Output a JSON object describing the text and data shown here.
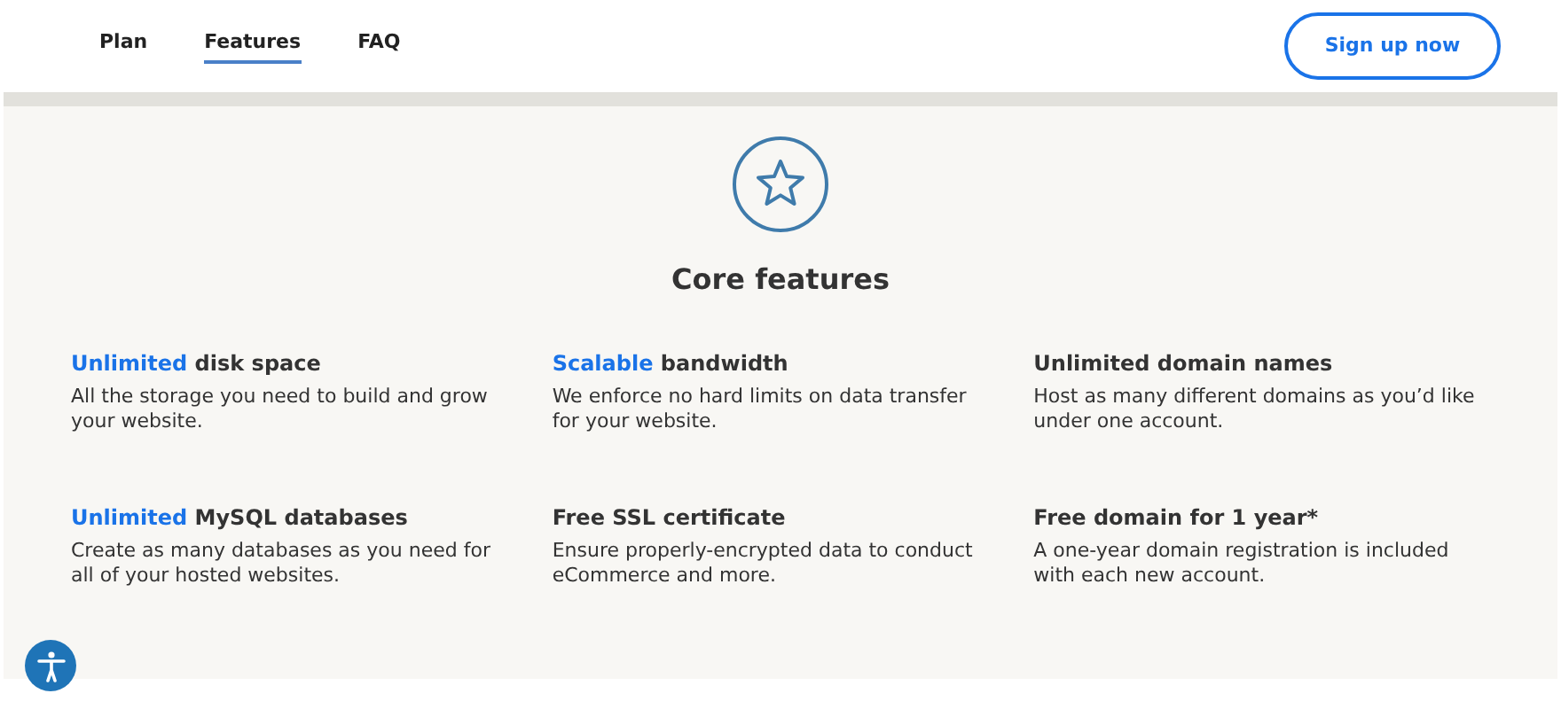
{
  "nav": {
    "links": [
      {
        "label": "Plan",
        "selected": false
      },
      {
        "label": "Features",
        "selected": true
      },
      {
        "label": "FAQ",
        "selected": false
      }
    ],
    "cta": "Sign up now"
  },
  "section": {
    "title": "Core features",
    "features": [
      {
        "highlight": "Unlimited",
        "title": "disk space",
        "description": "All the storage you need to build and grow your website."
      },
      {
        "highlight": "Scalable",
        "title": "bandwidth",
        "description": "We enforce no hard limits on data transfer for your website."
      },
      {
        "title": "Unlimited domain names",
        "description": "Host as many different domains as you’d like under one account."
      },
      {
        "highlight": "Unlimited",
        "title": "MySQL databases",
        "description": "Create as many databases as you need for all of your hosted websites."
      },
      {
        "title": "Free SSL certificate",
        "description": "Ensure properly-encrypted data to conduct eCommerce and more."
      },
      {
        "title": "Free domain for 1 year*",
        "description": "A one-year domain registration is included with each new account."
      }
    ]
  }
}
